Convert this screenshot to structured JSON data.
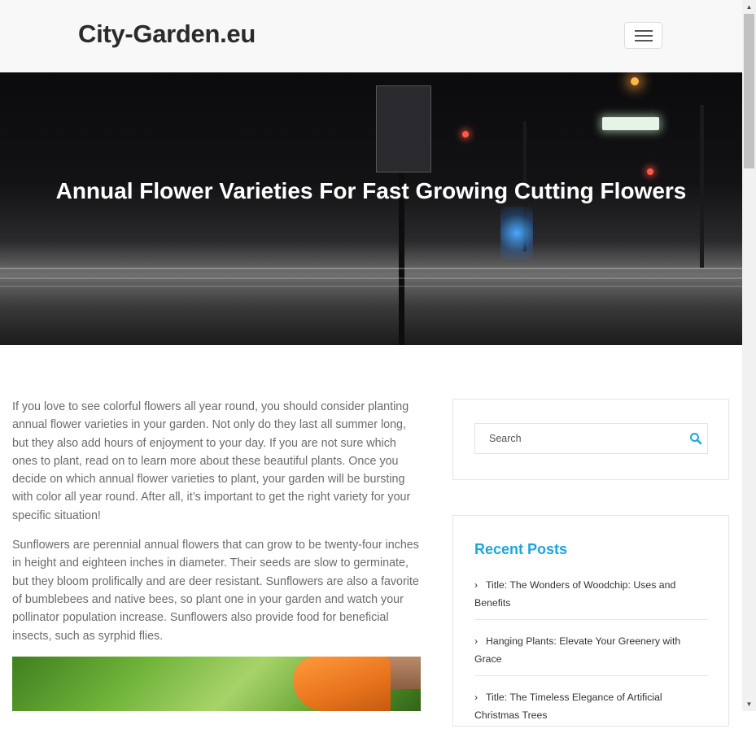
{
  "header": {
    "brand": "City-Garden.eu",
    "menu_icon": "hamburger-icon"
  },
  "hero": {
    "title": "Annual Flower Varieties For Fast Growing Cutting Flowers"
  },
  "article": {
    "paragraphs": [
      "If you love to see colorful flowers all year round, you should consider planting annual flower varieties in your garden. Not only do they last all summer long, but they also add hours of enjoyment to your day. If you are not sure which ones to plant, read on to learn more about these beautiful plants. Once you decide on which annual flower varieties to plant, your garden will be bursting with color all year round. After all, it’s important to get the right variety for your specific situation!",
      "Sunflowers are perennial annual flowers that can grow to be twenty-four inches in height and eighteen inches in diameter. Their seeds are slow to germinate, but they bloom prolifically and are deer resistant. Sunflowers are also a favorite of bumblebees and native bees, so plant one in your garden and watch your pollinator population increase. Sunflowers also provide food for beneficial insects, such as syrphid flies."
    ]
  },
  "sidebar": {
    "search": {
      "placeholder": "Search",
      "icon": "search-icon"
    },
    "recent_posts": {
      "title": "Recent Posts",
      "items": [
        {
          "label": "Title: The Wonders of Woodchip: Uses and Benefits"
        },
        {
          "label": "Hanging Plants: Elevate Your Greenery with Grace"
        },
        {
          "label": "Title: The Timeless Elegance of Artificial Christmas Trees"
        }
      ]
    }
  },
  "colors": {
    "accent": "#1ea4de",
    "brand_text": "#2b2b2b",
    "body_text": "#6b6b6b"
  }
}
